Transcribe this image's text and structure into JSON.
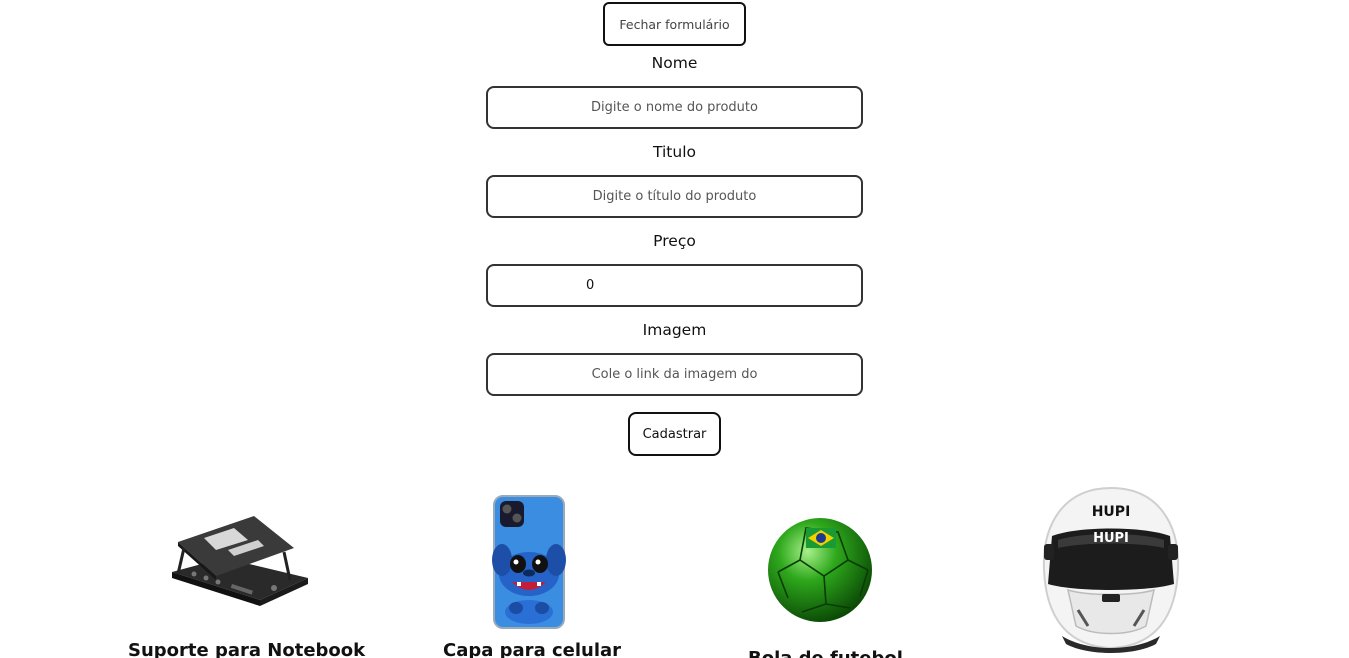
{
  "form": {
    "close_label": "Fechar formulário",
    "fields": [
      {
        "label": "Nome",
        "placeholder": "Digite o nome do produto",
        "value": ""
      },
      {
        "label": "Titulo",
        "placeholder": "Digite o título do produto",
        "value": ""
      },
      {
        "label": "Preço",
        "placeholder": "",
        "value": "0"
      },
      {
        "label": "Imagem",
        "placeholder": "Cole o link da imagem do",
        "value": ""
      }
    ],
    "submit_label": "Cadastrar"
  },
  "products": [
    {
      "title": "Suporte para Notebook",
      "image": "laptop-stand-image"
    },
    {
      "title": "Capa para celular",
      "image": "phone-case-image"
    },
    {
      "title": "Bola de futebol",
      "image": "soccer-ball-image"
    },
    {
      "title": "",
      "image": "racing-helmet-image"
    }
  ],
  "helmet_brand": "HUPI"
}
